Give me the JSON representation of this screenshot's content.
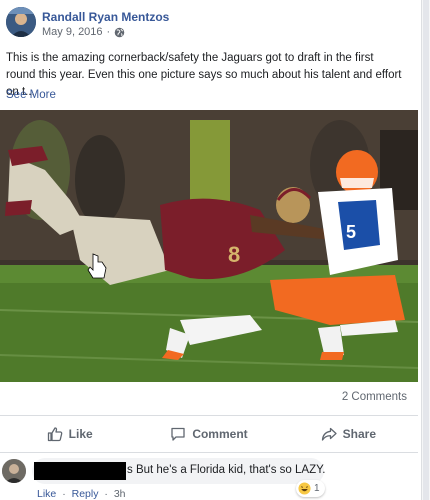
{
  "post": {
    "author": "Randall Ryan Mentzos",
    "date": "May 9, 2016",
    "separator": "·",
    "privacy_icon": "globe-icon",
    "text": "This is the amazing cornerback/safety the Jaguars got to draft in the first round this year. Even this one picture says so much about his talent and effort on t...",
    "see_more": "See More",
    "photo_description_icon": "football-photo",
    "comments_count": "2 Comments"
  },
  "actions": {
    "like": "Like",
    "comment": "Comment",
    "share": "Share"
  },
  "comment": {
    "text": "s But he's a Florida kid, that's so LAZY.",
    "reaction_emoji": "haha-icon",
    "reaction_count": "1",
    "like_label": "Like",
    "reply_label": "Reply",
    "separator": "·",
    "time": "3h"
  },
  "colors": {
    "link_blue": "#385898",
    "meta_gray": "#606770",
    "bubble_bg": "#f2f3f5",
    "field_green": "#4f7a2a",
    "fsu_garnet": "#7b1e2a",
    "uf_orange": "#f26a21",
    "uf_blue": "#1b4fa8"
  }
}
